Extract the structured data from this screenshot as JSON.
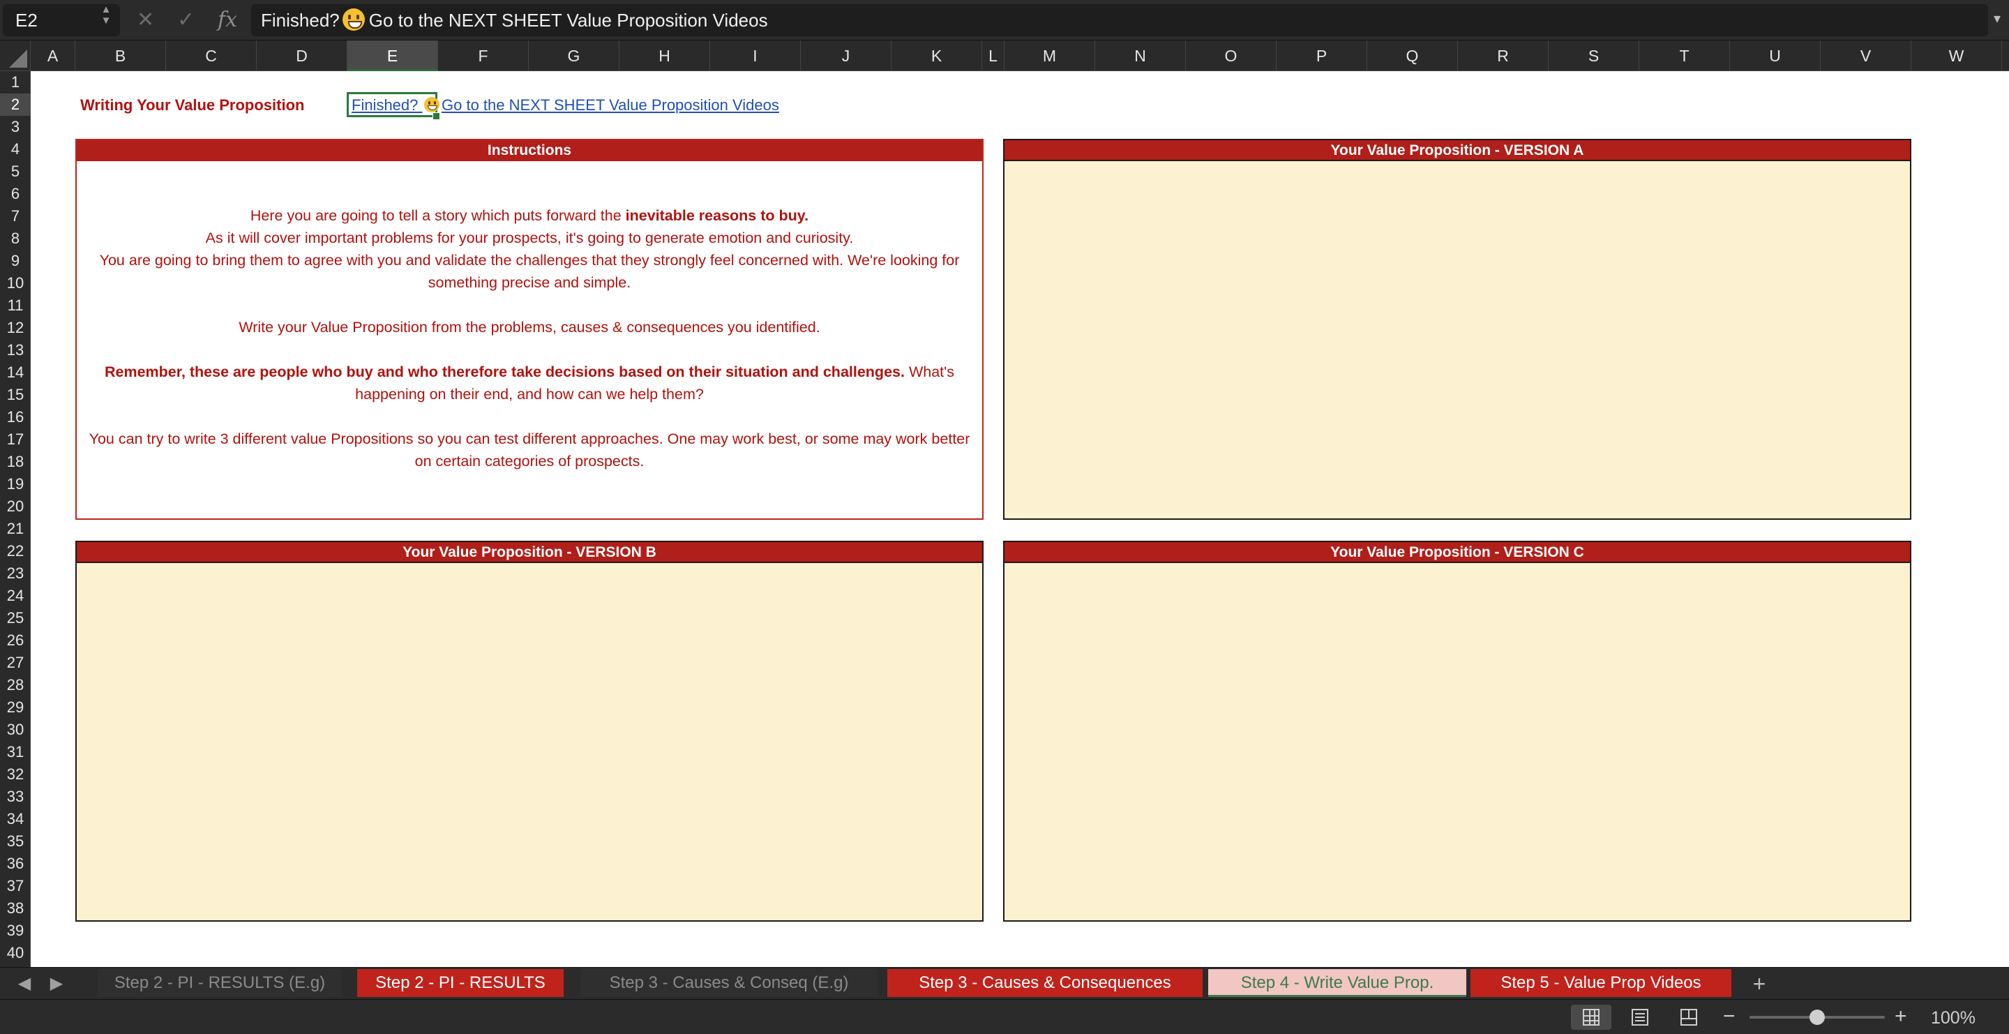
{
  "formula_bar": {
    "name_box": "E2",
    "fx_label": "fx",
    "content_before_emoji": "Finished?",
    "content_after_emoji": "Go to the NEXT SHEET Value Proposition Videos"
  },
  "grid": {
    "columns": [
      "A",
      "B",
      "C",
      "D",
      "E",
      "F",
      "G",
      "H",
      "I",
      "J",
      "K",
      "L",
      "M",
      "N",
      "O",
      "P",
      "Q",
      "R",
      "S",
      "T",
      "U",
      "V",
      "W"
    ],
    "selected_column": "E",
    "selected_row": "2",
    "rows": [
      "1",
      "2",
      "3",
      "4",
      "5",
      "6",
      "7",
      "8",
      "9",
      "10",
      "11",
      "12",
      "13",
      "14",
      "15",
      "16",
      "17",
      "18",
      "19",
      "20",
      "21",
      "22",
      "23",
      "24",
      "25",
      "26",
      "27",
      "28",
      "29",
      "30",
      "31",
      "32",
      "33",
      "34",
      "35",
      "36",
      "37",
      "38",
      "39",
      "40"
    ]
  },
  "sheet": {
    "title": "Writing Your Value Proposition",
    "link_part1": "Finished?",
    "link_part2": "Go to the NEXT SHEET Value Proposition Videos ",
    "instructions": {
      "header": "Instructions",
      "p1_a": "Here you are going to tell a story which puts forward the ",
      "p1_b": "inevitable reasons to buy.",
      "p2": "As it will cover important problems for your prospects, it's going to generate emotion and curiosity.",
      "p3": "You are going to bring them to agree with you and validate the challenges that they strongly feel concerned with. We're looking for something precise and simple.",
      "p4": "Write your Value Proposition from the problems, causes & consequences you identified.",
      "p5_a": "Remember, these are people who buy and who therefore take decisions based on their situation and challenges.",
      "p5_b": " What's happening on their end, and how can we help them?",
      "p6": "You can try to write 3 different value Propositions so you can test different approaches. One may work best, or some may work better on certain categories of prospects."
    },
    "version_a_header": "Your Value Proposition - VERSION A",
    "version_b_header": "Your Value Proposition - VERSION B",
    "version_c_header": "Your Value Proposition - VERSION C"
  },
  "tabs": [
    {
      "label": "Step 2 - PI - RESULTS (E.g)",
      "style": "grey"
    },
    {
      "label": "Step 2 - PI - RESULTS",
      "style": "red"
    },
    {
      "label": "Step 3 - Causes & Conseq (E.g)",
      "style": "grey"
    },
    {
      "label": "Step 3 - Causes & Consequences",
      "style": "red"
    },
    {
      "label": "Step 4 - Write Value Prop.",
      "style": "active"
    },
    {
      "label": "Step 5 - Value Prop Videos",
      "style": "red"
    }
  ],
  "tab_add_label": "+",
  "status": {
    "zoom": "100%",
    "zoom_level": 1.0
  },
  "colors": {
    "header_red": "#b01f19",
    "text_red": "#b2120e",
    "panel_fill": "#fcf1d0",
    "link_blue": "#1f4fb5",
    "selection_green": "#2a7a3c"
  },
  "icons": [
    "cancel-icon",
    "confirm-icon",
    "function-icon",
    "expand-icon",
    "scroll-left-icon",
    "scroll-right-icon",
    "add-sheet-icon",
    "normal-view-icon",
    "page-layout-icon",
    "page-break-icon",
    "zoom-out-icon",
    "zoom-in-icon",
    "smiley-emoji-icon"
  ]
}
